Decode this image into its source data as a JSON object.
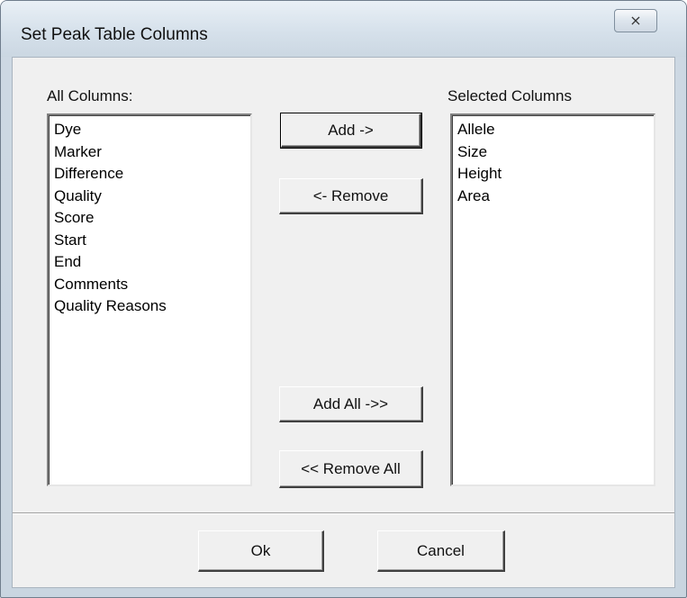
{
  "window": {
    "title": "Set Peak Table Columns",
    "close_glyph": "⨯"
  },
  "all_columns": {
    "label": "All Columns:",
    "items": [
      "Dye",
      "Marker",
      "Difference",
      "Quality",
      "Score",
      "Start",
      "End",
      "Comments",
      "Quality Reasons"
    ]
  },
  "selected_columns": {
    "label": "Selected Columns",
    "items": [
      "Allele",
      "Size",
      "Height",
      "Area"
    ]
  },
  "buttons": {
    "add": "Add ->",
    "remove": "<- Remove",
    "add_all": "Add All ->>",
    "remove_all": "<< Remove All",
    "ok": "Ok",
    "cancel": "Cancel"
  },
  "colors": {
    "titlebar": "#d6e1eb",
    "dialog_face": "#f0f0f0",
    "list_background": "#ffffff"
  }
}
